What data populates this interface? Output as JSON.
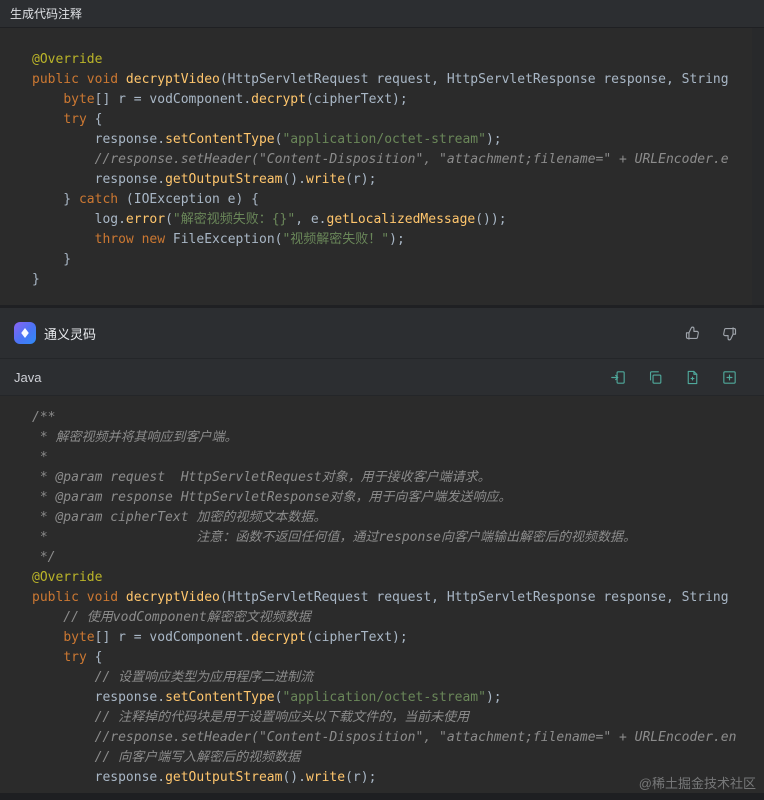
{
  "header": {
    "title": "生成代码注释"
  },
  "assistant": {
    "name": "通义灵码"
  },
  "result": {
    "language": "Java"
  },
  "watermark": {
    "text": "@稀土掘金技术社区"
  },
  "icons": {
    "logo": "tongyi-lingma-logo-icon",
    "feedback": [
      "thumbs-up-icon",
      "thumbs-down-icon"
    ],
    "toolbar": [
      "insert-code-icon",
      "copy-icon",
      "new-file-icon",
      "add-box-icon"
    ]
  },
  "colors": {
    "panel_bg": "#2b2d30",
    "code_bg": "#2b2b2b",
    "keyword": "#cc7832",
    "method": "#ffc66d",
    "string": "#6a8759",
    "comment": "#8c8c8c",
    "annotation": "#bbb529",
    "plain_code": "#a9b7c6",
    "toolbar_icon_teal": "#4fa89b",
    "feedback_icon_gray": "#9fa4ab",
    "logo_gradient_start": "#8a63f4",
    "logo_gradient_end": "#2e8cf6"
  },
  "original_code": {
    "lines": [
      [
        {
          "t": "ann",
          "s": "@Override"
        }
      ],
      [
        {
          "t": "kw",
          "s": "public void "
        },
        {
          "t": "m",
          "s": "decryptVideo"
        },
        {
          "t": "pl",
          "s": "(HttpServletRequest request, HttpServletResponse response, String"
        }
      ],
      [
        {
          "t": "pl",
          "s": "    "
        },
        {
          "t": "kw",
          "s": "byte"
        },
        {
          "t": "pl",
          "s": "[] r = vodComponent."
        },
        {
          "t": "m",
          "s": "decrypt"
        },
        {
          "t": "pl",
          "s": "(cipherText);"
        }
      ],
      [
        {
          "t": "pl",
          "s": "    "
        },
        {
          "t": "kw",
          "s": "try"
        },
        {
          "t": "pl",
          "s": " {"
        }
      ],
      [
        {
          "t": "pl",
          "s": "        response."
        },
        {
          "t": "m",
          "s": "setContentType"
        },
        {
          "t": "pl",
          "s": "("
        },
        {
          "t": "str",
          "s": "\"application/octet-stream\""
        },
        {
          "t": "pl",
          "s": ");"
        }
      ],
      [
        {
          "t": "cm",
          "s": "        //response.setHeader(\"Content-Disposition\", \"attachment;filename=\" + URLEncoder.e"
        }
      ],
      [
        {
          "t": "pl",
          "s": "        response."
        },
        {
          "t": "m",
          "s": "getOutputStream"
        },
        {
          "t": "pl",
          "s": "()."
        },
        {
          "t": "m",
          "s": "write"
        },
        {
          "t": "pl",
          "s": "(r);"
        }
      ],
      [
        {
          "t": "pl",
          "s": "    } "
        },
        {
          "t": "kw",
          "s": "catch"
        },
        {
          "t": "pl",
          "s": " (IOException e) {"
        }
      ],
      [
        {
          "t": "pl",
          "s": "        log."
        },
        {
          "t": "m",
          "s": "error"
        },
        {
          "t": "pl",
          "s": "("
        },
        {
          "t": "str",
          "s": "\"解密视频失败：{}\""
        },
        {
          "t": "pl",
          "s": ", e."
        },
        {
          "t": "m",
          "s": "getLocalizedMessage"
        },
        {
          "t": "pl",
          "s": "());"
        }
      ],
      [
        {
          "t": "pl",
          "s": "        "
        },
        {
          "t": "kw",
          "s": "throw new "
        },
        {
          "t": "pl",
          "s": "FileException("
        },
        {
          "t": "str",
          "s": "\"视频解密失败！\""
        },
        {
          "t": "pl",
          "s": ");"
        }
      ],
      [
        {
          "t": "pl",
          "s": "    }"
        }
      ],
      [
        {
          "t": "pl",
          "s": "}"
        }
      ]
    ]
  },
  "generated_code": {
    "lines": [
      [
        {
          "t": "cm",
          "s": "/**"
        }
      ],
      [
        {
          "t": "cm",
          "s": " * 解密视频并将其响应到客户端。"
        }
      ],
      [
        {
          "t": "cm",
          "s": " *"
        }
      ],
      [
        {
          "t": "cm",
          "s": " * @param request  HttpServletRequest对象，用于接收客户端请求。"
        }
      ],
      [
        {
          "t": "cm",
          "s": " * @param response HttpServletResponse对象，用于向客户端发送响应。"
        }
      ],
      [
        {
          "t": "cm",
          "s": " * @param cipherText 加密的视频文本数据。"
        }
      ],
      [
        {
          "t": "cm",
          "s": " *                   注意：函数不返回任何值，通过response向客户端输出解密后的视频数据。"
        }
      ],
      [
        {
          "t": "cm",
          "s": " */"
        }
      ],
      [
        {
          "t": "ann",
          "s": "@Override"
        }
      ],
      [
        {
          "t": "kw",
          "s": "public void "
        },
        {
          "t": "m",
          "s": "decryptVideo"
        },
        {
          "t": "pl",
          "s": "(HttpServletRequest request, HttpServletResponse response, String"
        }
      ],
      [
        {
          "t": "cm",
          "s": "    // 使用vodComponent解密密文视频数据"
        }
      ],
      [
        {
          "t": "pl",
          "s": "    "
        },
        {
          "t": "kw",
          "s": "byte"
        },
        {
          "t": "pl",
          "s": "[] r = vodComponent."
        },
        {
          "t": "m",
          "s": "decrypt"
        },
        {
          "t": "pl",
          "s": "(cipherText);"
        }
      ],
      [
        {
          "t": "pl",
          "s": "    "
        },
        {
          "t": "kw",
          "s": "try"
        },
        {
          "t": "pl",
          "s": " {"
        }
      ],
      [
        {
          "t": "cm",
          "s": "        // 设置响应类型为应用程序二进制流"
        }
      ],
      [
        {
          "t": "pl",
          "s": "        response."
        },
        {
          "t": "m",
          "s": "setContentType"
        },
        {
          "t": "pl",
          "s": "("
        },
        {
          "t": "str",
          "s": "\"application/octet-stream\""
        },
        {
          "t": "pl",
          "s": ");"
        }
      ],
      [
        {
          "t": "cm",
          "s": "        // 注释掉的代码块是用于设置响应头以下载文件的，当前未使用"
        }
      ],
      [
        {
          "t": "cm",
          "s": "        //response.setHeader(\"Content-Disposition\", \"attachment;filename=\" + URLEncoder.en"
        }
      ],
      [
        {
          "t": "cm",
          "s": "        // 向客户端写入解密后的视频数据"
        }
      ],
      [
        {
          "t": "pl",
          "s": "        response."
        },
        {
          "t": "m",
          "s": "getOutputStream"
        },
        {
          "t": "pl",
          "s": "()."
        },
        {
          "t": "m",
          "s": "write"
        },
        {
          "t": "pl",
          "s": "(r);"
        }
      ]
    ]
  }
}
